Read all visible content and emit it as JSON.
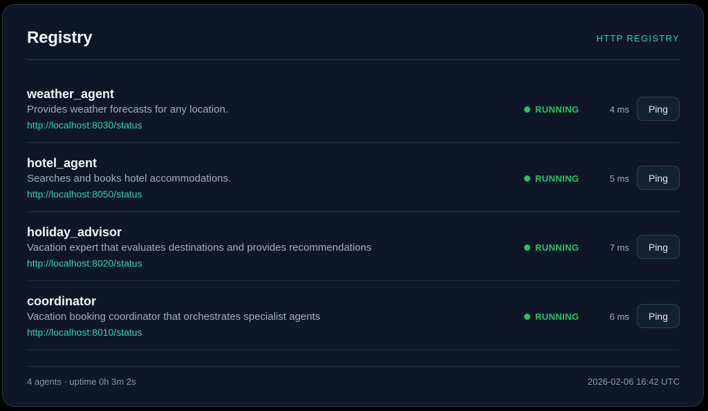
{
  "header": {
    "title": "Registry",
    "badge": "HTTP REGISTRY"
  },
  "agents": [
    {
      "name": "weather_agent",
      "description": "Provides weather forecasts for any location.",
      "url": "http://localhost:8030/status",
      "status": "RUNNING",
      "latency": "4 ms",
      "ping_label": "Ping"
    },
    {
      "name": "hotel_agent",
      "description": "Searches and books hotel accommodations.",
      "url": "http://localhost:8050/status",
      "status": "RUNNING",
      "latency": "5 ms",
      "ping_label": "Ping"
    },
    {
      "name": "holiday_advisor",
      "description": "Vacation expert that evaluates destinations and provides recommendations",
      "url": "http://localhost:8020/status",
      "status": "RUNNING",
      "latency": "7 ms",
      "ping_label": "Ping"
    },
    {
      "name": "coordinator",
      "description": "Vacation booking coordinator that orchestrates specialist agents",
      "url": "http://localhost:8010/status",
      "status": "RUNNING",
      "latency": "6 ms",
      "ping_label": "Ping"
    }
  ],
  "footer": {
    "summary": "4 agents · uptime 0h 3m 2s",
    "timestamp": "2026-02-06 16:42 UTC"
  },
  "colors": {
    "accent": "#2fd4b5",
    "running": "#22c55e",
    "background": "#0e1628"
  },
  "icons": {
    "status_indicator": "status-dot-icon"
  }
}
